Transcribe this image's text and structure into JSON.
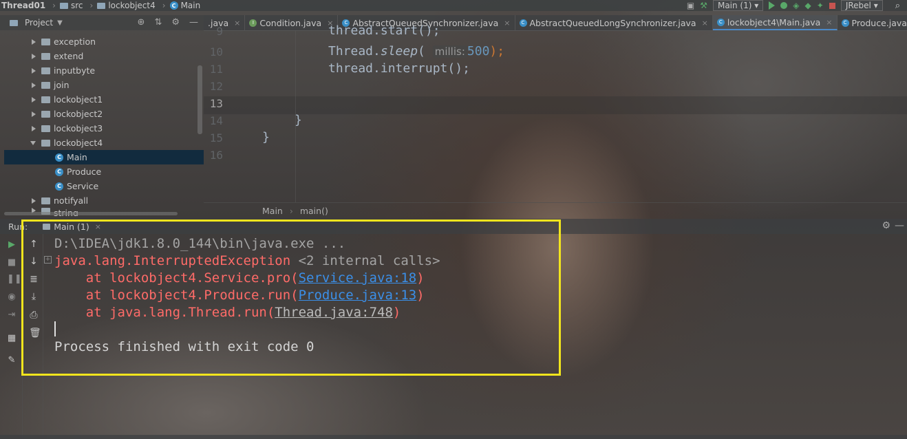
{
  "navbar": {
    "project": "Thread01",
    "crumbs": [
      "src",
      "lockobject4",
      "Main"
    ],
    "run_config": "Main (1)",
    "plugin": "JRebel"
  },
  "project_panel": {
    "title": "Project",
    "items": [
      {
        "label": "exception",
        "type": "folder",
        "expanded": false
      },
      {
        "label": "extend",
        "type": "folder",
        "expanded": false
      },
      {
        "label": "inputbyte",
        "type": "folder",
        "expanded": false
      },
      {
        "label": "join",
        "type": "folder",
        "expanded": false
      },
      {
        "label": "lockobject1",
        "type": "folder",
        "expanded": false
      },
      {
        "label": "lockobject2",
        "type": "folder",
        "expanded": false
      },
      {
        "label": "lockobject3",
        "type": "folder",
        "expanded": false
      },
      {
        "label": "lockobject4",
        "type": "folder",
        "expanded": true
      },
      {
        "label": "Main",
        "type": "class",
        "selected": true
      },
      {
        "label": "Produce",
        "type": "class"
      },
      {
        "label": "Service",
        "type": "class"
      },
      {
        "label": "notifyall",
        "type": "folder",
        "expanded": false
      },
      {
        "label": "string",
        "type": "folder",
        "expanded": false
      }
    ]
  },
  "tabs": [
    {
      "label": ".java"
    },
    {
      "label": "Condition.java"
    },
    {
      "label": "AbstractQueuedSynchronizer.java"
    },
    {
      "label": "AbstractQueuedLongSynchronizer.java"
    },
    {
      "label": "lockobject4\\Main.java",
      "active": true
    },
    {
      "label": "Produce.java"
    }
  ],
  "editor": {
    "line_numbers": [
      "9",
      "10",
      "11",
      "12",
      "13",
      "14",
      "15",
      "16"
    ],
    "line9": "thread.start();",
    "line10_a": "Thread.",
    "line10_method": "sleep",
    "line10_b": "(",
    "line10_hint": "millis:",
    "line10_num": "500",
    "line10_c": ");",
    "line11": "thread.interrupt();",
    "line14": "}",
    "line15": "}",
    "breadcrumb": [
      "Main",
      "main()"
    ]
  },
  "run_panel": {
    "label": "Run:",
    "tab": "Main (1)",
    "console": {
      "cmd": "D:\\IDEA\\jdk1.8.0_144\\bin\\java.exe ...",
      "exception": "java.lang.InterruptedException",
      "internal": " <2 internal calls>",
      "frame1_pre": "    at lockobject4.Service.pro(",
      "frame1_link": "Service.java:18",
      "frame1_post": ")",
      "frame2_pre": "    at lockobject4.Produce.run(",
      "frame2_link": "Produce.java:13",
      "frame2_post": ")",
      "frame3_pre": "    at java.lang.Thread.run(",
      "frame3_link": "Thread.java:748",
      "frame3_post": ")",
      "exit": "Process finished with exit code 0"
    }
  },
  "colors": {
    "highlight_border": "#f2e51d",
    "error_text": "#ff6b68",
    "link": "#3b8fe8"
  }
}
